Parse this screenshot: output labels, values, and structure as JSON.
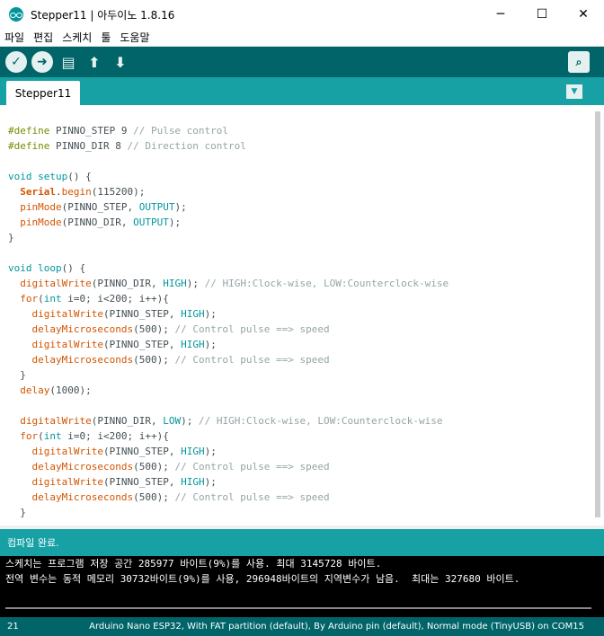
{
  "window": {
    "title": "Stepper11 | 아두이노 1.8.16",
    "min": "─",
    "max": "☐",
    "close": "✕"
  },
  "menu": [
    "파일",
    "편집",
    "스케치",
    "툴",
    "도움말"
  ],
  "toolbar": {
    "verify": "✓",
    "upload": "➜",
    "new": "▤",
    "open": "⬆",
    "save": "⬇",
    "serial": "⌕"
  },
  "tab": {
    "name": "Stepper11",
    "menu": "▼"
  },
  "status": "컴파일 완료.",
  "console": [
    "스케치는 프로그램 저장 공간 285977 바이트(9%)를 사용. 최대 3145728 바이트.",
    "전역 변수는 동적 메모리 30732바이트(9%)를 사용, 296948바이트의 지역변수가 남음.  최대는 327680 바이트."
  ],
  "footer": {
    "line": "21",
    "board": "Arduino Nano ESP32, With FAT partition (default), By Arduino pin (default), Normal mode (TinyUSB) on COM15"
  }
}
